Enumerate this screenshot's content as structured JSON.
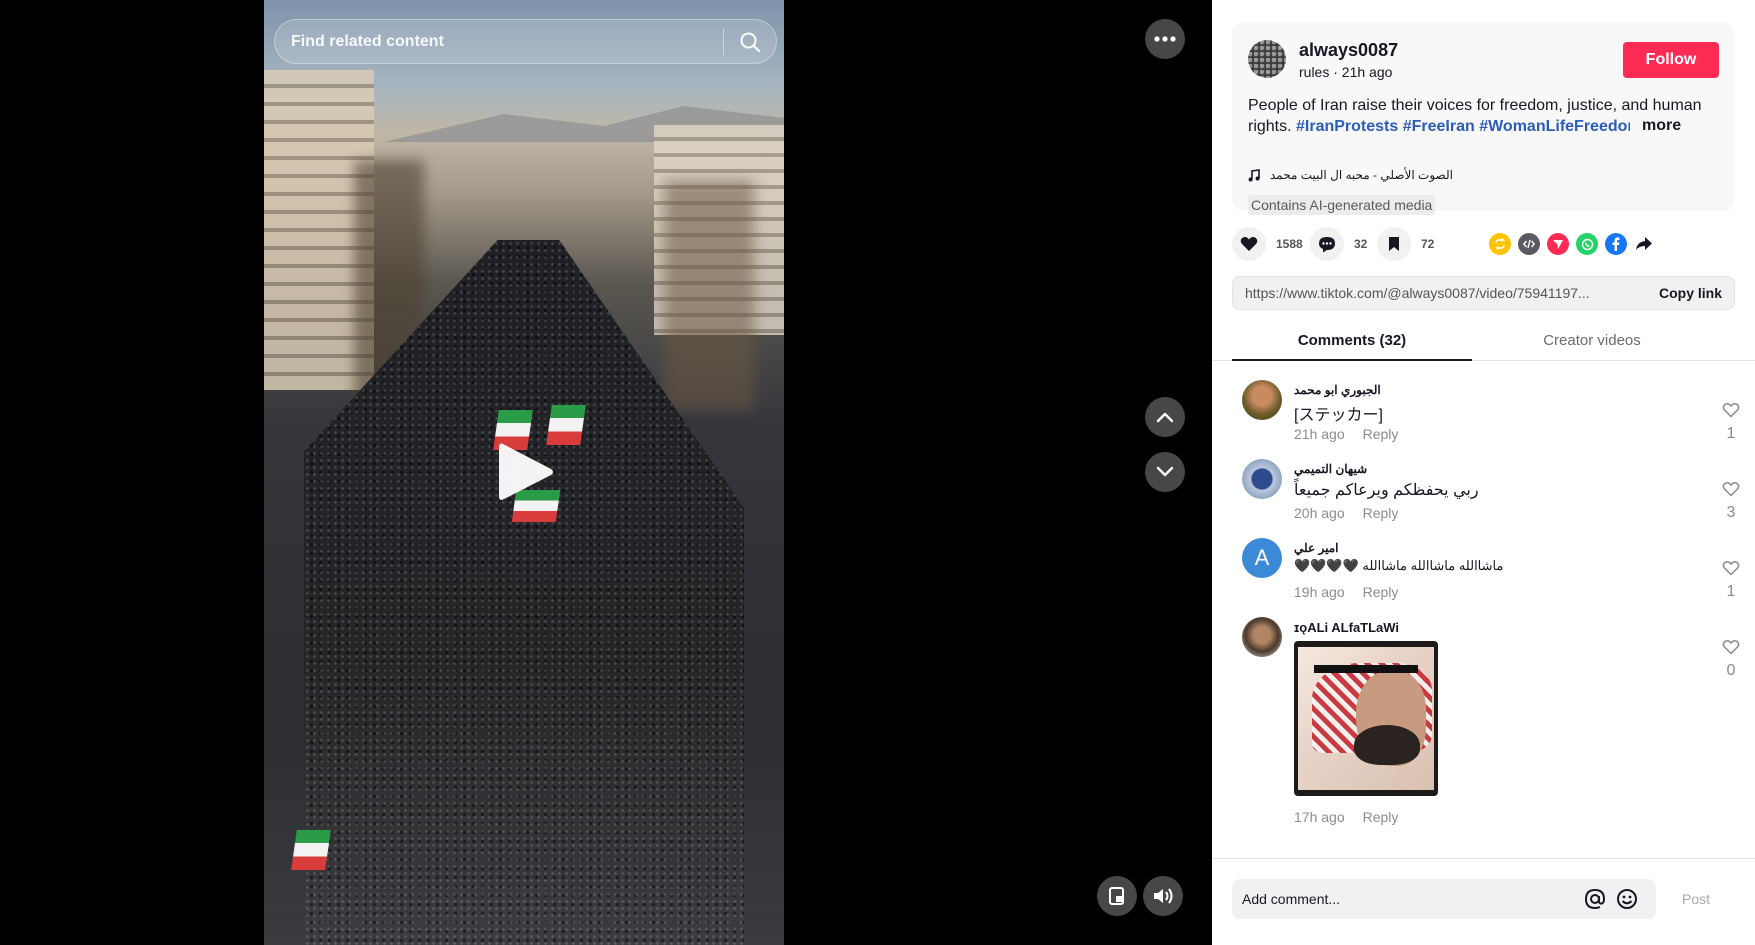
{
  "search": {
    "placeholder": "Find related content"
  },
  "author": {
    "name": "always0087",
    "meta": "rules · 21h ago",
    "follow_label": "Follow"
  },
  "description": {
    "text": "People of Iran raise their voices for freedom, justice, and human rights. ",
    "tags": "#IranProtests #FreeIran #WomanLifeFreedom...",
    "more_label": "more"
  },
  "music": {
    "title": "الصوت الأصلي - محبه ال البيت محمد"
  },
  "ai_label": "Contains AI-generated media",
  "actions": {
    "likes": "1588",
    "comments": "32",
    "saves": "72"
  },
  "share_icons": [
    {
      "name": "repost-icon",
      "color": "#ffc300"
    },
    {
      "name": "embed-icon",
      "color": "#5a5b62"
    },
    {
      "name": "send-icon",
      "color": "#fe2c55"
    },
    {
      "name": "whatsapp-icon",
      "color": "#25d366"
    },
    {
      "name": "facebook-icon",
      "color": "#1877f2"
    },
    {
      "name": "share-arrow-icon",
      "color": "#161823"
    }
  ],
  "link": {
    "url": "https://www.tiktok.com/@always0087/video/75941197...",
    "copy_label": "Copy link"
  },
  "tabs": {
    "comments": "Comments (32)",
    "creator": "Creator videos"
  },
  "comments": [
    {
      "user": "الجبوري ابو محمد",
      "text": "[ステッカー]",
      "time": "21h ago",
      "reply": "Reply",
      "likes": "1"
    },
    {
      "user": "شيهان التميمي",
      "text": "ربي يحفظكم ويرعاكم جميعاً",
      "time": "20h ago",
      "reply": "Reply",
      "likes": "3"
    },
    {
      "user": "امير علي",
      "avatar_letter": "A",
      "text": "🖤🖤🖤🖤 ماشاالله ماشاالله ماشاالله",
      "time": "19h ago",
      "reply": "Reply",
      "likes": "1"
    },
    {
      "user": "ɪǫALi ALfaTLaWi",
      "text": "",
      "time": "17h ago",
      "reply": "Reply",
      "likes": "0"
    }
  ],
  "composer": {
    "placeholder": "Add comment...",
    "post_label": "Post"
  }
}
